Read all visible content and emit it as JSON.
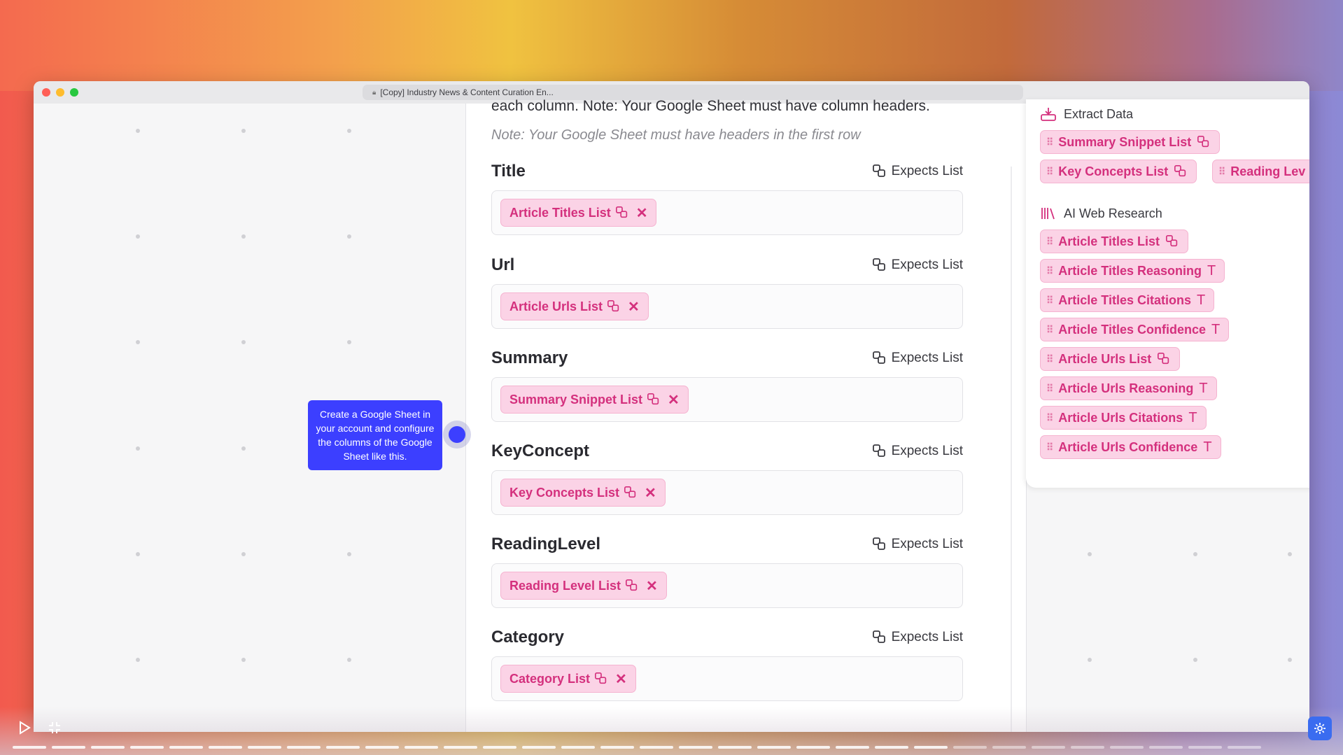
{
  "window": {
    "tab_title": "[Copy] Industry News & Content Curation En..."
  },
  "panel": {
    "intro": "each column. Note: Your Google Sheet must have column headers.",
    "note": "Note: Your Google Sheet must have headers in the first row",
    "expects_label": "Expects List",
    "fields": [
      {
        "label": "Title",
        "chip": "Article Titles List"
      },
      {
        "label": "Url",
        "chip": "Article Urls List"
      },
      {
        "label": "Summary",
        "chip": "Summary Snippet List"
      },
      {
        "label": "KeyConcept",
        "chip": "Key Concepts List"
      },
      {
        "label": "ReadingLevel",
        "chip": "Reading Level List"
      },
      {
        "label": "Category",
        "chip": "Category List"
      }
    ]
  },
  "right_panel": {
    "extract_title": "Extract Data",
    "extract_chips": [
      "Summary Snippet List",
      "Key Concepts List",
      "Reading Lev"
    ],
    "research_title": "AI Web Research",
    "research_chips": [
      "Article Titles List",
      "Article Titles Reasoning",
      "Article Titles Citations",
      "Article Titles Confidence",
      "Article Urls List",
      "Article Urls Reasoning",
      "Article Urls Citations",
      "Article Urls Confidence"
    ]
  },
  "tooltip": {
    "text": "Create a Google Sheet in your account and configure the columns of the Google Sheet like this."
  },
  "colors": {
    "chip_bg": "#fbd3e6",
    "chip_text": "#d4307d",
    "accent": "#3c3fff"
  },
  "icons": {
    "list": "list-icon",
    "text": "text-type-icon",
    "close": "close-icon",
    "grip": "drag-handle-icon"
  }
}
